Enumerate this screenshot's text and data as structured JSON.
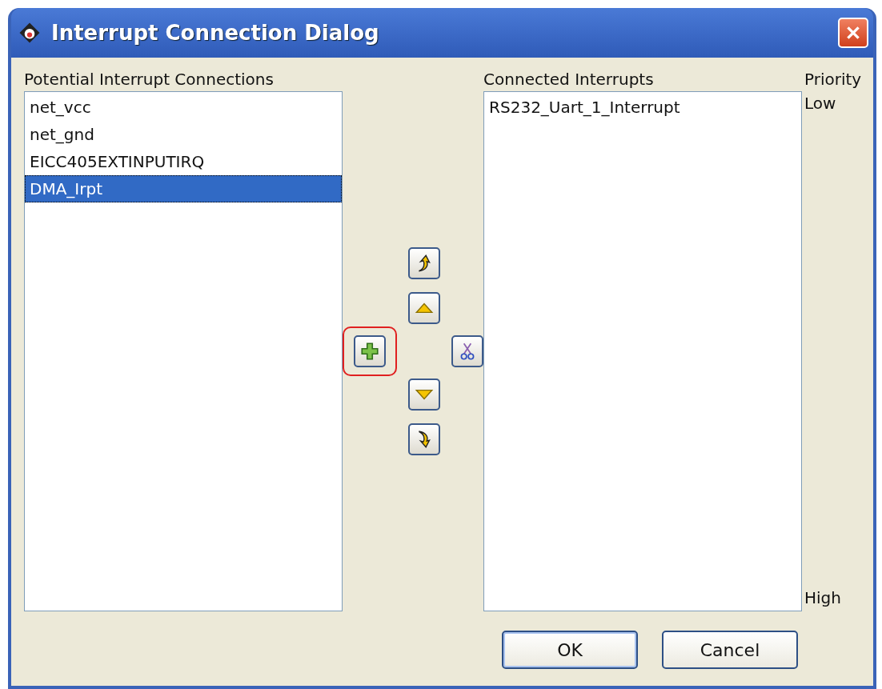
{
  "window": {
    "title": "Interrupt Connection Dialog"
  },
  "potential": {
    "heading": "Potential Interrupt Connections",
    "items": [
      {
        "label": "net_vcc",
        "selected": false
      },
      {
        "label": "net_gnd",
        "selected": false
      },
      {
        "label": "EICC405EXTINPUTIRQ",
        "selected": false
      },
      {
        "label": "DMA_Irpt",
        "selected": true
      }
    ]
  },
  "tools": [
    {
      "kind": "add",
      "highlighted": true
    },
    {
      "kind": "top",
      "highlighted": false
    },
    {
      "kind": "up",
      "highlighted": false
    },
    {
      "kind": "down",
      "highlighted": false
    },
    {
      "kind": "bottom",
      "highlighted": false
    },
    {
      "kind": "remove",
      "highlighted": false
    }
  ],
  "connected": {
    "heading": "Connected Interrupts",
    "items": [
      {
        "label": "RS232_Uart_1_Interrupt",
        "selected": false
      }
    ]
  },
  "priority": {
    "heading": "Priority",
    "low": "Low",
    "high": "High"
  },
  "buttons": [
    {
      "label": "OK",
      "default": true
    },
    {
      "label": "Cancel",
      "default": false
    }
  ]
}
